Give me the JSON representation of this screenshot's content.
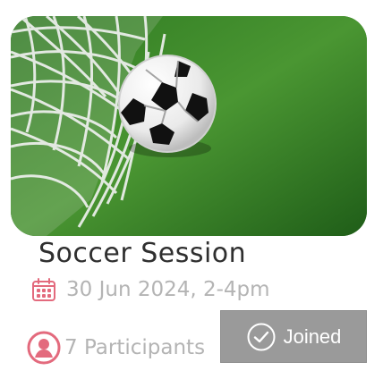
{
  "event": {
    "title": "Soccer Session",
    "date_text": "30 Jun 2024, 2-4pm",
    "participants_text": "7 Participants",
    "status_button_label": "Joined"
  },
  "icons": {
    "date": "calendar-icon",
    "participants": "user-avatar-icon",
    "status": "check-circle-icon"
  },
  "colors": {
    "title": "#2f2f2f",
    "meta": "#b4b4b4",
    "calendar": "#e36a7d",
    "avatar": "#e36a7d",
    "button_bg": "#9a9a9a",
    "button_text": "#ffffff"
  }
}
